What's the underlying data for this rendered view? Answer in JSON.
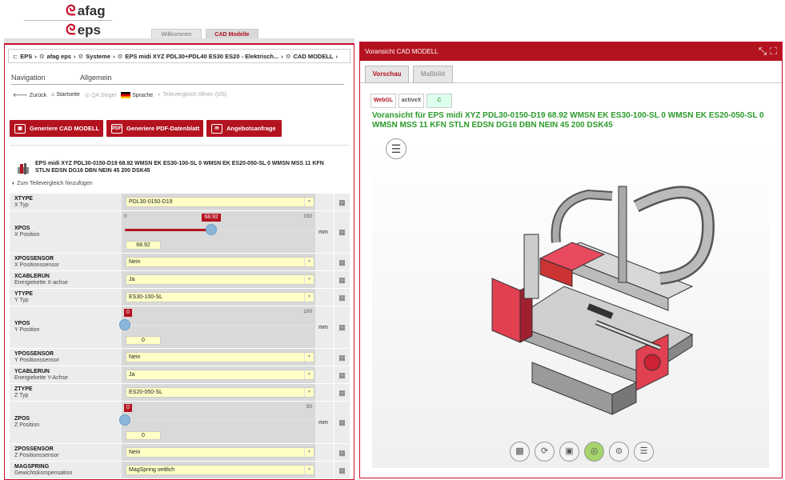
{
  "brand": {
    "afag": "afag",
    "eps": "eps"
  },
  "top_tabs": [
    {
      "label": "Willkommen"
    },
    {
      "label": "CAD Modelle"
    }
  ],
  "breadcrumb": [
    "EPS",
    "afag eps",
    "Systeme",
    "EPS midi XYZ PDL30+PDL40 ES30 ES20 - Elektrisch...",
    "CAD MODELL"
  ],
  "nav_tabs": {
    "navigation": "Navigation",
    "general": "Allgemein"
  },
  "actions": {
    "back": "Zurück",
    "home": "Startseite",
    "qa": "QA Siegel",
    "language": "Sprache",
    "compare": "Teilevergleich öffnen (0/5)"
  },
  "buttons": {
    "cad": "Generiere CAD MODELL",
    "pdf": "Generiere PDF-Datenblatt",
    "quote": "Angebotsanfrage"
  },
  "product": {
    "title": "EPS midi XYZ PDL30-0150-D19 68.92 WMSN EK ES30-100-SL 0 WMSN EK ES20-050-SL 0 WMSN MSS 11 KFN STLN EDSN DG16 DBN NEIN 45 200 DSK45",
    "compare_link": "Zum Teilevergleich hinzufügen"
  },
  "params": {
    "xtype": {
      "name": "XTYPE",
      "desc": "X Typ",
      "value": "PDL30-0150-D19"
    },
    "xpos": {
      "name": "XPOS",
      "desc": "X Position",
      "min": "0",
      "max": "150",
      "value": "68.92",
      "unit": "mm",
      "fraction": 0.459
    },
    "xpossensor": {
      "name": "XPOSSENSOR",
      "desc": "X Positionssensor",
      "value": "Nein"
    },
    "xcablerun": {
      "name": "XCABLERUN",
      "desc": "Energiekette X-achse",
      "value": "Ja"
    },
    "ytype": {
      "name": "YTYPE",
      "desc": "Y Typ",
      "value": "ES30-100-SL"
    },
    "ypos": {
      "name": "YPOS",
      "desc": "Y Position",
      "min": "0",
      "max": "100",
      "value": "0",
      "unit": "mm",
      "fraction": 0
    },
    "ypossensor": {
      "name": "YPOSSENSOR",
      "desc": "Y Positionssensor",
      "value": "Nein"
    },
    "ycablerun": {
      "name": "YCABLERUN",
      "desc": "Energiekette Y-Achse",
      "value": "Ja"
    },
    "ztype": {
      "name": "ZTYPE",
      "desc": "Z Typ",
      "value": "ES20-050-SL"
    },
    "zpos": {
      "name": "ZPOS",
      "desc": "Z Position",
      "min": "0",
      "max": "50",
      "value": "0",
      "unit": "mm",
      "fraction": 0
    },
    "zpossensor": {
      "name": "ZPOSSENSOR",
      "desc": "Z Positionssensor",
      "value": "Nein"
    },
    "magspring": {
      "name": "MAGSPRING",
      "desc": "Gewichtskompensation",
      "value": "MagSpring seitlich"
    }
  },
  "preview": {
    "header": "Voransicht CAD MODELL",
    "tabs": {
      "preview": "Vorschau",
      "dimension": "Maßbild"
    },
    "badges": [
      "WebGL",
      "activeX",
      "C"
    ],
    "title": "Voransicht für EPS midi XYZ PDL30-0150-D19 68.92 WMSN EK ES30-100-SL 0 WMSN EK ES20-050-SL 0 WMSN MSS 11 KFN STLN EDSN DG16 DBN NEIN 45 200 DSK45"
  },
  "colors": {
    "accent": "#b3131f",
    "green_title": "#2b9a2b",
    "input_bg": "#ffffc6"
  }
}
